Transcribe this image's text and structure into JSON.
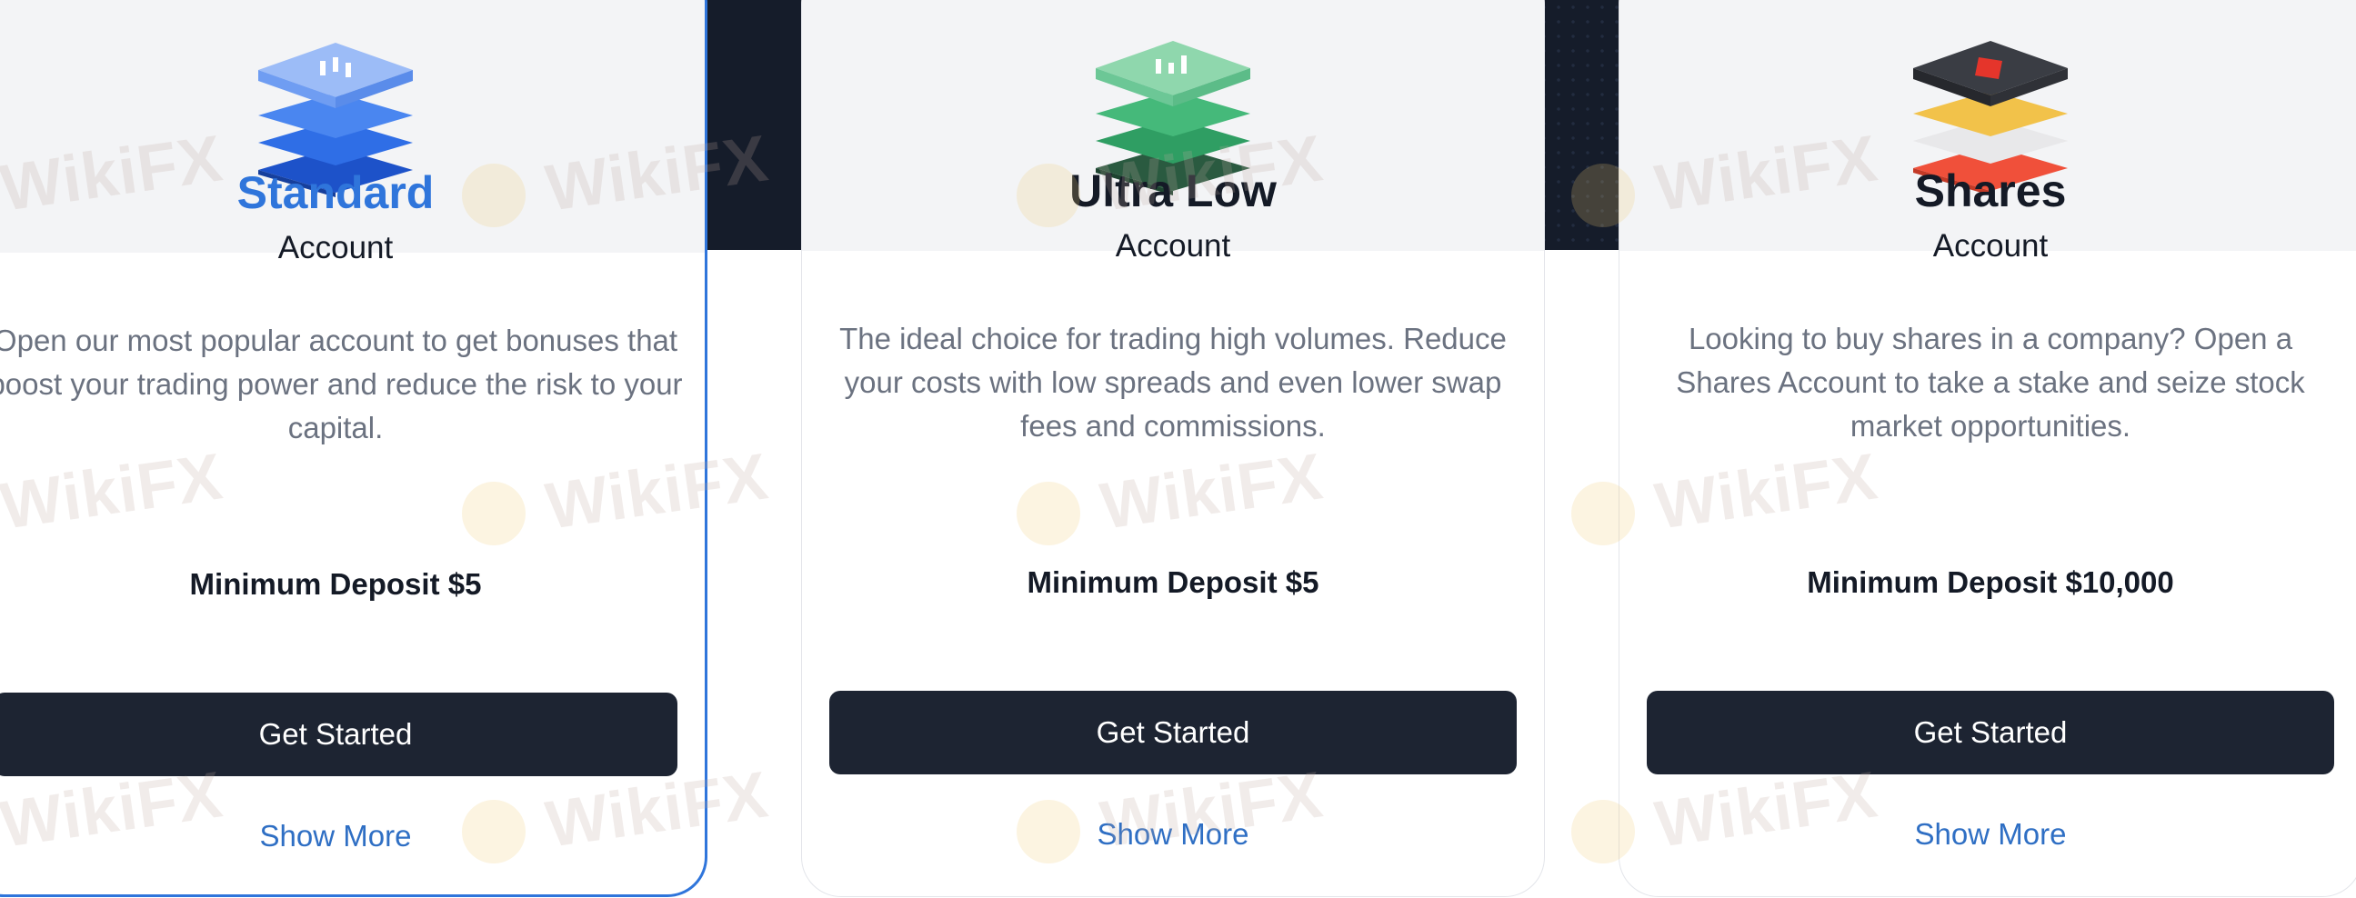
{
  "cards": [
    {
      "title": "Standard",
      "subtitle": "Account",
      "description": "Open our most popular account to get bonuses that boost your trading power and reduce the risk to your capital.",
      "deposit": "Minimum Deposit $5",
      "cta": "Get Started",
      "more": "Show More",
      "icon": "blue-stacked-layers-icon",
      "accent": "#2f75db",
      "selected": true
    },
    {
      "title": "Ultra Low",
      "subtitle": "Account",
      "description": "The ideal choice for trading high volumes. Reduce your costs with low spreads and even lower swap fees and commissions.",
      "deposit": "Minimum Deposit $5",
      "cta": "Get Started",
      "more": "Show More",
      "icon": "green-stacked-layers-icon",
      "accent": "#3fb57a",
      "selected": false
    },
    {
      "title": "Shares",
      "subtitle": "Account",
      "description": "Looking to buy shares in a company? Open a Shares Account to take a stake and seize stock market opportunities.",
      "deposit": "Minimum Deposit $10,000",
      "cta": "Get Started",
      "more": "Show More",
      "icon": "shares-stacked-layers-icon",
      "accent": "#f0503a",
      "selected": false
    }
  ],
  "colors": {
    "header_band": "#151c2a",
    "button": "#1d2432",
    "link": "#2f6fc4",
    "selected_border": "#2f75db"
  },
  "watermark": "WikiFX"
}
